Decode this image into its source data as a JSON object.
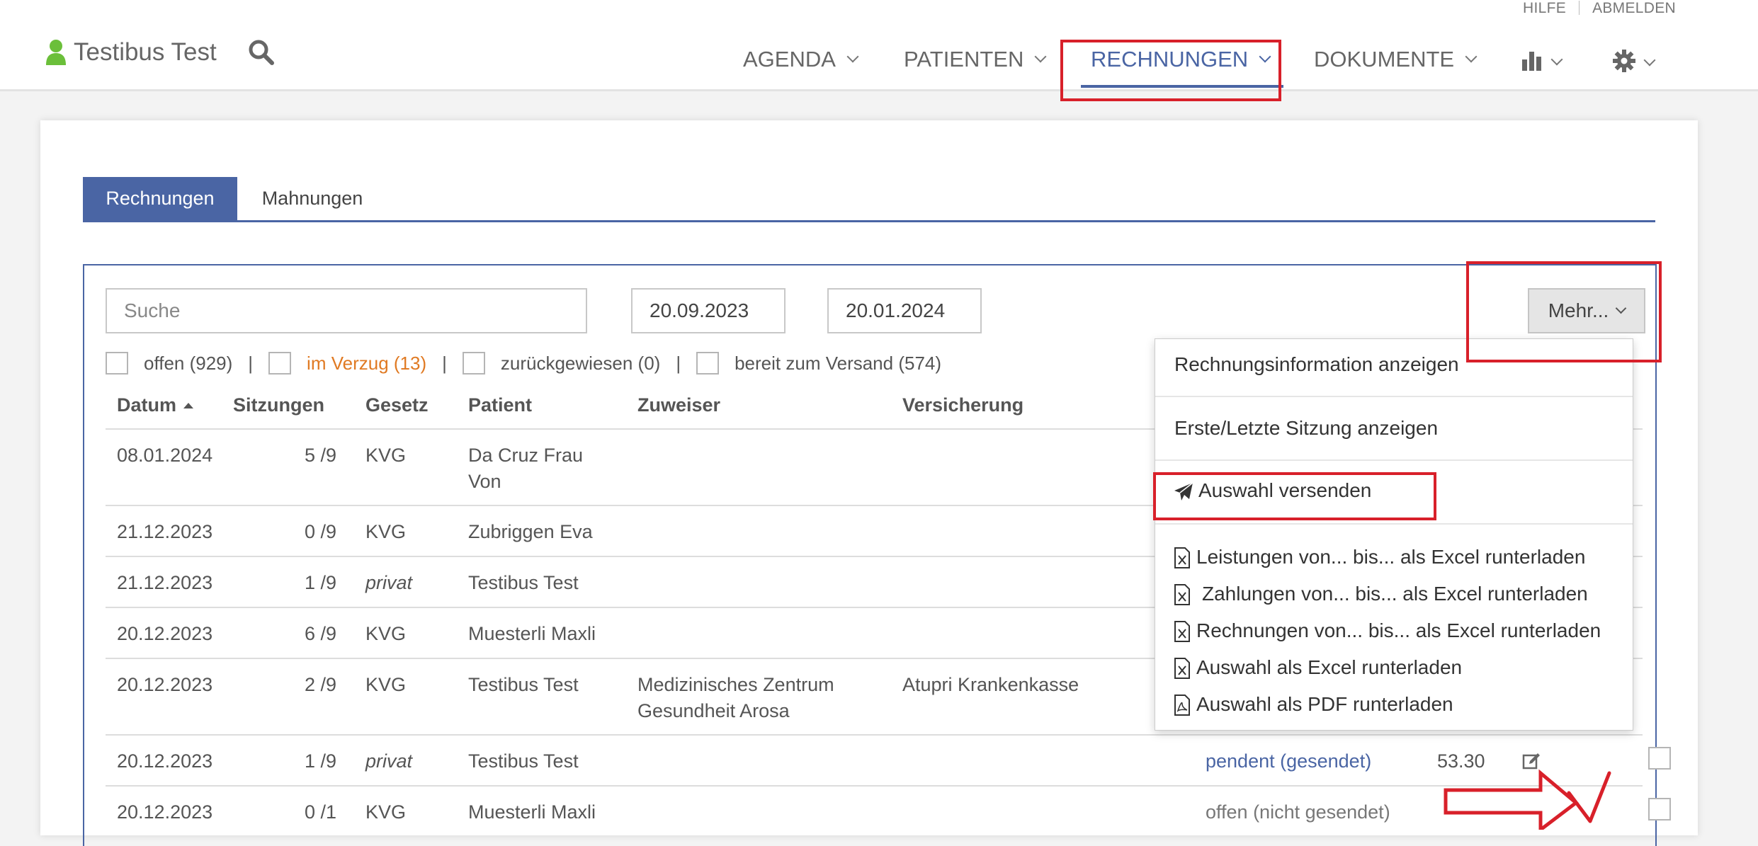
{
  "header": {
    "help_label": "HILFE",
    "logout_label": "ABMELDEN",
    "brand_name": "Testibus Test",
    "nav": [
      {
        "label": "AGENDA"
      },
      {
        "label": "PATIENTEN"
      },
      {
        "label": "RECHNUNGEN"
      },
      {
        "label": "DOKUMENTE"
      }
    ],
    "icons": [
      "user-icon",
      "search-icon",
      "bar-chart-icon",
      "gear-icon"
    ],
    "accent_color": "#4a65a4"
  },
  "tabs": [
    "Rechnungen",
    "Mahnungen"
  ],
  "filters": {
    "search_placeholder": "Suche",
    "date_from": "20.09.2023",
    "date_to": "20.01.2024",
    "more_button": "Mehr...",
    "checkboxes": [
      {
        "label": "offen (929)"
      },
      {
        "label": "im Verzug (13)",
        "color": "#e07a23"
      },
      {
        "label": "zurückgewiesen (0)"
      },
      {
        "label": "bereit zum Versand (574)"
      }
    ],
    "separator": "|"
  },
  "table": {
    "columns": [
      "Datum",
      "Sitzungen",
      "Gesetz",
      "Patient",
      "Zuweiser",
      "Versicherung"
    ],
    "rows": [
      {
        "datum": "08.01.2024",
        "sitzungen": "5 /9",
        "gesetz": "KVG",
        "patient_1": "Da Cruz Frau",
        "patient_2": "Von"
      },
      {
        "datum": "21.12.2023",
        "sitzungen": "0 /9",
        "gesetz": "KVG",
        "patient_1": "Zubriggen Eva"
      },
      {
        "datum": "21.12.2023",
        "sitzungen": "1 /9",
        "gesetz": "privat",
        "patient_1": "Testibus Test"
      },
      {
        "datum": "20.12.2023",
        "sitzungen": "6 /9",
        "gesetz": "KVG",
        "patient_1": "Muesterli Maxli"
      },
      {
        "datum": "20.12.2023",
        "sitzungen": "2 /9",
        "gesetz": "KVG",
        "patient_1": "Testibus Test",
        "zuweiser_1": "Medizinisches Zentrum",
        "zuweiser_2": "Gesundheit Arosa",
        "versicherung": "Atupri Krankenkasse"
      },
      {
        "datum": "20.12.2023",
        "sitzungen": "1 /9",
        "gesetz": "privat",
        "patient_1": "Testibus Test",
        "status": "pendent (gesendet)",
        "betrag": "53.30"
      },
      {
        "datum": "20.12.2023",
        "sitzungen": "0 /1",
        "gesetz": "KVG",
        "patient_1": "Muesterli Maxli",
        "status": "offen (nicht gesendet)"
      }
    ]
  },
  "more_menu": {
    "items": [
      "Rechnungsinformation anzeigen",
      "Erste/Letzte Sitzung anzeigen",
      "Auswahl versenden",
      "Leistungen von... bis... als Excel runterladen",
      "Zahlungen von... bis... als Excel runterladen",
      "Rechnungen von... bis... als Excel runterladen",
      "Auswahl als Excel runterladen",
      "Auswahl als PDF runterladen"
    ]
  },
  "annotation_color": "#d8202a"
}
